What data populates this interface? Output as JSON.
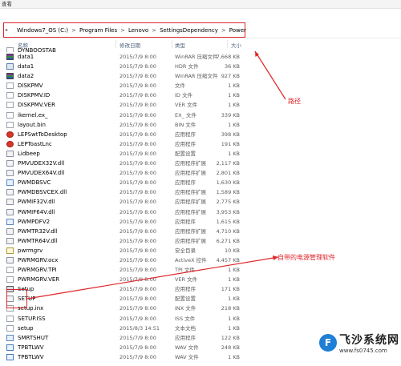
{
  "window": {
    "top_label": "查看"
  },
  "address": {
    "crumbs": [
      "Windows7_OS (C:)",
      "Program Files",
      "Lenovo",
      "SettingsDependency",
      "Power"
    ],
    "separator": ">"
  },
  "columns": {
    "name": "名称",
    "date": "修改日期",
    "type": "类型",
    "size": "大小"
  },
  "files": [
    {
      "name": "DYNBOOSTAB",
      "date": "",
      "type": "",
      "size": "",
      "icon": "document-icon",
      "cls": "ic-doc"
    },
    {
      "name": "data1",
      "date": "2015/7/9 8:00",
      "type": "WinRAR 压缩文件",
      "size": "7,668 KB",
      "icon": "rar-archive-icon",
      "cls": "ic-rar"
    },
    {
      "name": "data1",
      "date": "2015/7/9 8:00",
      "type": "HDR 文件",
      "size": "36 KB",
      "icon": "hdr-file-icon",
      "cls": "ic-hdr"
    },
    {
      "name": "data2",
      "date": "2015/7/9 8:00",
      "type": "WinRAR 压缩文件",
      "size": "927 KB",
      "icon": "rar-archive-icon",
      "cls": "ic-rar"
    },
    {
      "name": "DISKPMV",
      "date": "2015/7/9 8:00",
      "type": "文件",
      "size": "1 KB",
      "icon": "document-icon",
      "cls": "ic-doc"
    },
    {
      "name": "DISKPMV.ID",
      "date": "2015/7/9 8:00",
      "type": "ID 文件",
      "size": "1 KB",
      "icon": "document-icon",
      "cls": "ic-doc"
    },
    {
      "name": "DISKPMV.VER",
      "date": "2015/7/9 8:00",
      "type": "VER 文件",
      "size": "1 KB",
      "icon": "document-icon",
      "cls": "ic-doc"
    },
    {
      "name": "ikernel.ex_",
      "date": "2015/7/9 8:00",
      "type": "EX_ 文件",
      "size": "339 KB",
      "icon": "document-icon",
      "cls": "ic-doc"
    },
    {
      "name": "layout.bin",
      "date": "2015/7/9 8:00",
      "type": "BIN 文件",
      "size": "1 KB",
      "icon": "document-icon",
      "cls": "ic-doc"
    },
    {
      "name": "LEPSwtToDesktop",
      "date": "2015/7/9 8:00",
      "type": "应用程序",
      "size": "398 KB",
      "icon": "lenovo-app-icon",
      "cls": "ic-red"
    },
    {
      "name": "LEPToastLnc",
      "date": "2015/7/9 8:00",
      "type": "应用程序",
      "size": "191 KB",
      "icon": "lenovo-app-icon",
      "cls": "ic-red"
    },
    {
      "name": "Lidbeep",
      "date": "2015/7/9 8:00",
      "type": "配置设置",
      "size": "1 KB",
      "icon": "config-file-icon",
      "cls": "ic-dll"
    },
    {
      "name": "PMVUDEX32V.dll",
      "date": "2015/7/9 8:00",
      "type": "应用程序扩展",
      "size": "2,117 KB",
      "icon": "dll-file-icon",
      "cls": "ic-dll"
    },
    {
      "name": "PMVUDEX64V.dll",
      "date": "2015/7/9 8:00",
      "type": "应用程序扩展",
      "size": "2,801 KB",
      "icon": "dll-file-icon",
      "cls": "ic-dll"
    },
    {
      "name": "PWMDBSVC",
      "date": "2015/7/9 8:00",
      "type": "应用程序",
      "size": "1,630 KB",
      "icon": "app-icon",
      "cls": "ic-exe"
    },
    {
      "name": "PWMDBSVCEX.dll",
      "date": "2015/7/9 8:00",
      "type": "应用程序扩展",
      "size": "1,589 KB",
      "icon": "dll-file-icon",
      "cls": "ic-dll"
    },
    {
      "name": "PWMIF32V.dll",
      "date": "2015/7/9 8:00",
      "type": "应用程序扩展",
      "size": "2,775 KB",
      "icon": "dll-file-icon",
      "cls": "ic-dll"
    },
    {
      "name": "PWMIF64V.dll",
      "date": "2015/7/9 8:00",
      "type": "应用程序扩展",
      "size": "3,953 KB",
      "icon": "dll-file-icon",
      "cls": "ic-dll"
    },
    {
      "name": "PWMPDFV2",
      "date": "2015/7/9 8:00",
      "type": "应用程序",
      "size": "1,615 KB",
      "icon": "app-icon",
      "cls": "ic-exe"
    },
    {
      "name": "PWMTR32V.dll",
      "date": "2015/7/9 8:00",
      "type": "应用程序扩展",
      "size": "4,710 KB",
      "icon": "dll-file-icon",
      "cls": "ic-dll"
    },
    {
      "name": "PWMTR64V.dll",
      "date": "2015/7/9 8:00",
      "type": "应用程序扩展",
      "size": "6,271 KB",
      "icon": "dll-file-icon",
      "cls": "ic-dll"
    },
    {
      "name": "pwrmgrv",
      "date": "2015/7/9 8:00",
      "type": "安全目录",
      "size": "10 KB",
      "icon": "security-catalog-icon",
      "cls": "ic-cat"
    },
    {
      "name": "PWRMGRV.ocx",
      "date": "2015/7/9 8:00",
      "type": "ActiveX 控件",
      "size": "4,457 KB",
      "icon": "activex-icon",
      "cls": "ic-dll"
    },
    {
      "name": "PWRMGRV.TPI",
      "date": "2015/7/9 8:00",
      "type": "TPI 文件",
      "size": "1 KB",
      "icon": "document-icon",
      "cls": "ic-doc"
    },
    {
      "name": "PWRMGRV.VER",
      "date": "2015/7/9 8:00",
      "type": "VER 文件",
      "size": "1 KB",
      "icon": "document-icon",
      "cls": "ic-doc"
    },
    {
      "name": "Setup",
      "date": "2015/7/9 8:00",
      "type": "应用程序",
      "size": "171 KB",
      "icon": "setup-app-icon",
      "cls": "ic-setup"
    },
    {
      "name": "SETUP",
      "date": "2015/7/9 8:00",
      "type": "配置设置",
      "size": "1 KB",
      "icon": "config-file-icon",
      "cls": "ic-dll"
    },
    {
      "name": "setup.inx",
      "date": "2015/7/9 8:00",
      "type": "INX 文件",
      "size": "218 KB",
      "icon": "document-icon",
      "cls": "ic-doc"
    },
    {
      "name": "SETUP.ISS",
      "date": "2015/7/9 8:00",
      "type": "ISS 文件",
      "size": "1 KB",
      "icon": "document-icon",
      "cls": "ic-doc"
    },
    {
      "name": "setup",
      "date": "2015/8/3 14:51",
      "type": "文本文档",
      "size": "1 KB",
      "icon": "text-file-icon",
      "cls": "ic-doc"
    },
    {
      "name": "SMRTSHUT",
      "date": "2015/7/9 8:00",
      "type": "应用程序",
      "size": "122 KB",
      "icon": "app-icon",
      "cls": "ic-exe"
    },
    {
      "name": "TPBTLWV",
      "date": "2015/7/9 8:00",
      "type": "WAV 文件",
      "size": "248 KB",
      "icon": "wav-file-icon",
      "cls": "ic-wav"
    },
    {
      "name": "TPBTLWV",
      "date": "2015/7/9 8:00",
      "type": "WAV 文件",
      "size": "1 KB",
      "icon": "wav-file-icon",
      "cls": "ic-wav"
    }
  ],
  "annotations": {
    "path": "路径",
    "setup": "自带的电源管理软件"
  },
  "watermark": {
    "title": "飞沙系统网",
    "url": "www.fs0745.com",
    "logo": "F"
  },
  "colors": {
    "annotation": "#e0252a",
    "header_text": "#4c607a"
  }
}
